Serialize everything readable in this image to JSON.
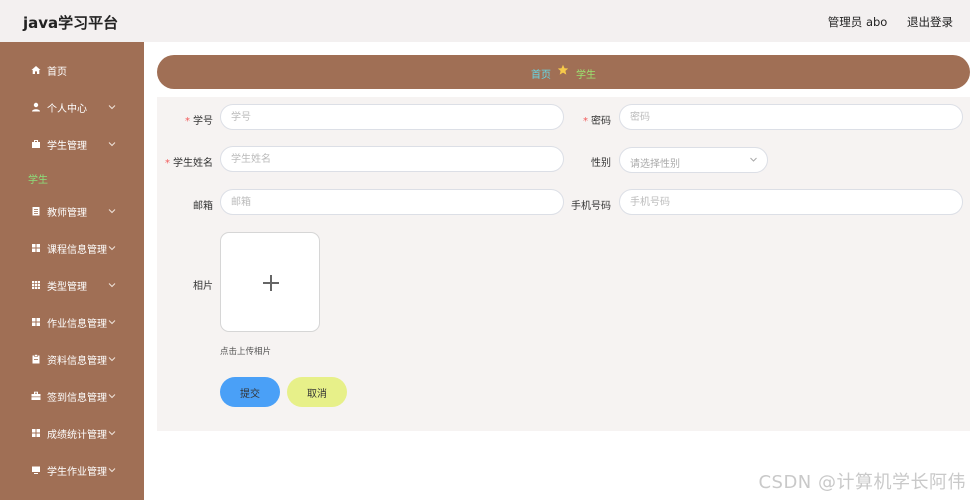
{
  "header": {
    "title": "java学习平台",
    "user_label": "管理员 abo",
    "logout_label": "退出登录"
  },
  "sidebar": {
    "items": [
      {
        "label": "首页",
        "icon": "home-icon"
      },
      {
        "label": "个人中心",
        "icon": "user-icon"
      },
      {
        "label": "学生管理",
        "icon": "briefcase-icon"
      },
      {
        "label": "学生",
        "active_sub": true
      },
      {
        "label": "教师管理",
        "icon": "clipboard-icon"
      },
      {
        "label": "课程信息管理",
        "icon": "grid-icon"
      },
      {
        "label": "类型管理",
        "icon": "apps-icon"
      },
      {
        "label": "作业信息管理",
        "icon": "grid-icon"
      },
      {
        "label": "资料信息管理",
        "icon": "doc-icon"
      },
      {
        "label": "签到信息管理",
        "icon": "case-icon"
      },
      {
        "label": "成绩统计管理",
        "icon": "grid-icon"
      },
      {
        "label": "学生作业管理",
        "icon": "monitor-icon"
      }
    ]
  },
  "breadcrumb": {
    "home": "首页",
    "current": "学生"
  },
  "form": {
    "student_no": {
      "label": "学号",
      "placeholder": "学号",
      "required": true
    },
    "password": {
      "label": "密码",
      "placeholder": "密码",
      "required": true
    },
    "student_name": {
      "label": "学生姓名",
      "placeholder": "学生姓名",
      "required": true
    },
    "gender": {
      "label": "性别",
      "placeholder": "请选择性别"
    },
    "email": {
      "label": "邮箱",
      "placeholder": "邮箱"
    },
    "phone": {
      "label": "手机号码",
      "placeholder": "手机号码"
    },
    "photo": {
      "label": "相片",
      "hint": "点击上传相片"
    },
    "submit_label": "提交",
    "cancel_label": "取消"
  },
  "watermark": "CSDN @计算机学长阿伟",
  "colors": {
    "sidebar_bg": "#a06f55",
    "breadcrumb_home": "#65d8e6",
    "breadcrumb_current": "#9ce36f",
    "active_sub": "#8be07b",
    "submit_bg": "#4aa0f7",
    "cancel_bg": "#e7f089",
    "required_star": "#f25b5b"
  }
}
